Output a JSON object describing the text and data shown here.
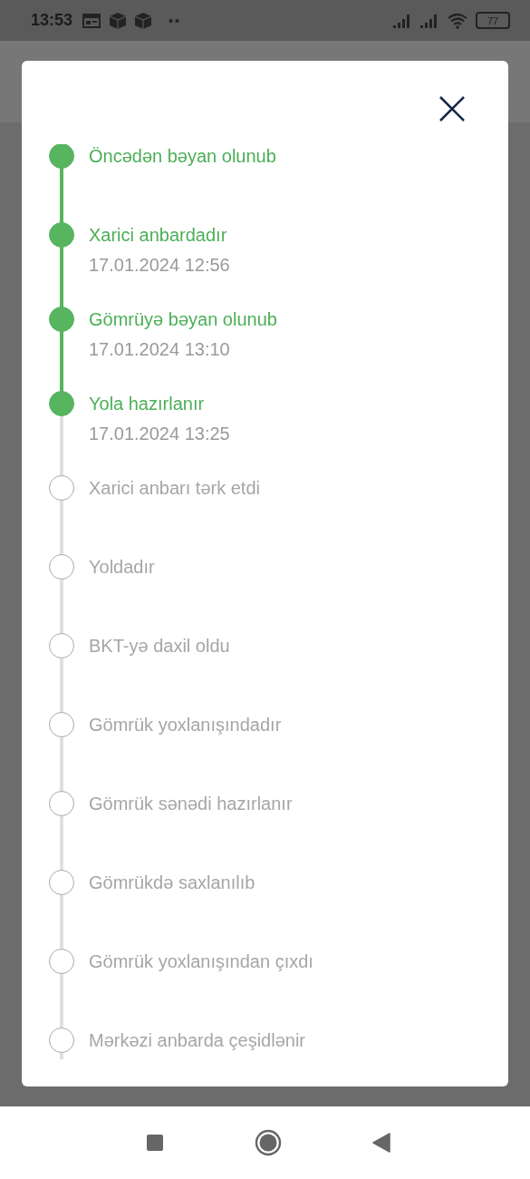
{
  "status_bar": {
    "time": "13:53",
    "battery": "77"
  },
  "steps": [
    {
      "title": "Öncədən bəyan olunub",
      "done": true
    },
    {
      "title": "Xarici anbardadır",
      "date": "17.01.2024 12:56",
      "done": true
    },
    {
      "title": "Gömrüyə bəyan olunub",
      "date": "17.01.2024 13:10",
      "done": true
    },
    {
      "title": "Yola hazırlanır",
      "date": "17.01.2024 13:25",
      "done": true
    },
    {
      "title": "Xarici anbarı tərk etdi",
      "done": false
    },
    {
      "title": "Yoldadır",
      "done": false
    },
    {
      "title": "BKT-yə daxil oldu",
      "done": false
    },
    {
      "title": "Gömrük yoxlanışındadır",
      "done": false
    },
    {
      "title": "Gömrük sənədi hazırlanır",
      "done": false
    },
    {
      "title": "Gömrükdə saxlanılıb",
      "done": false
    },
    {
      "title": "Gömrük yoxlanışından çıxdı",
      "done": false
    },
    {
      "title": "Mərkəzi anbarda çeşidlənir",
      "done": false
    }
  ]
}
